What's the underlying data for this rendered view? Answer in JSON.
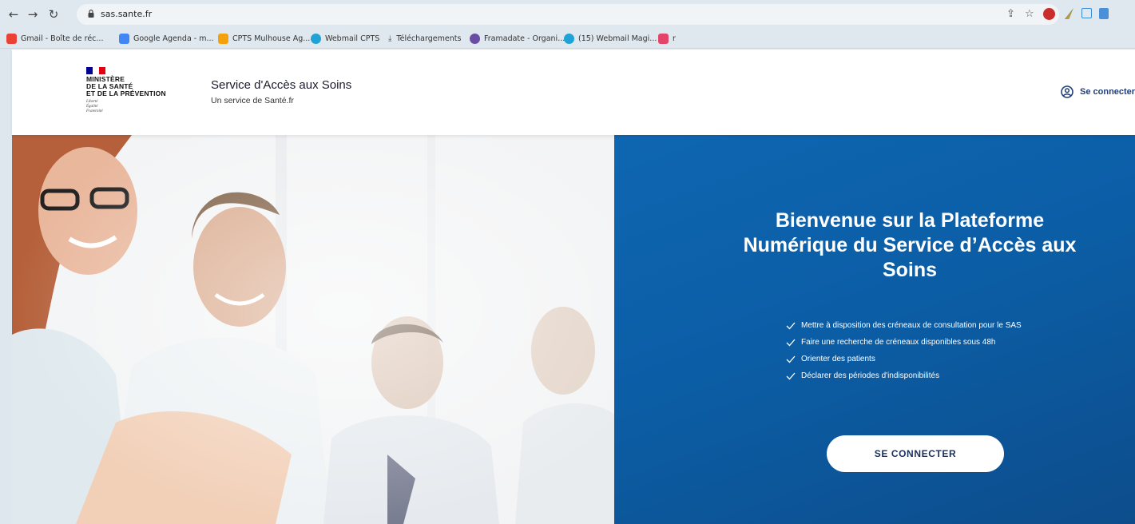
{
  "browser": {
    "url": "sas.sante.fr",
    "bookmarks": [
      {
        "label": "Gmail - Boîte de réc...",
        "color": "#ea4335"
      },
      {
        "label": "Google Agenda - m...",
        "color": "#4285f4"
      },
      {
        "label": "CPTS Mulhouse Ag...",
        "color": "#f4a20b"
      },
      {
        "label": "Webmail CPTS",
        "color": "#1fa2d6"
      },
      {
        "label": "Téléchargements",
        "color": "#555555"
      },
      {
        "label": "Framadate - Organi...",
        "color": "#6a4ea1"
      },
      {
        "label": "(15) Webmail Magi...",
        "color": "#1fa2d6"
      },
      {
        "label": "r",
        "color": "#e2446a"
      }
    ]
  },
  "header": {
    "ministry_lines": [
      "MINISTÈRE",
      "DE LA SANTÉ",
      "ET DE LA PRÉVENTION"
    ],
    "motto_lines": [
      "Liberté",
      "Égalité",
      "Fraternité"
    ],
    "title": "Service d'Accès aux Soins",
    "subtitle": "Un service de Santé.fr",
    "login_label": "Se connecter"
  },
  "hero": {
    "title": "Bienvenue sur la Plateforme Numérique du Service d’Accès aux Soins",
    "features": [
      "Mettre à disposition des créneaux de consultation pour le SAS",
      "Faire une recherche de créneaux disponibles sous 48h",
      "Orienter des patients",
      "Déclarer des périodes d'indisponibilités"
    ],
    "cta_label": "SE CONNECTER"
  },
  "colors": {
    "brand_blue": "#0b5ea6",
    "navy": "#1f3f7a"
  }
}
